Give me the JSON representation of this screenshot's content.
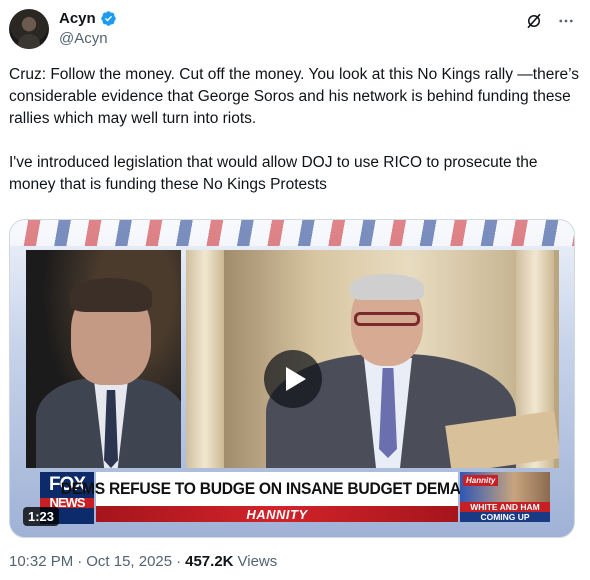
{
  "author": {
    "display_name": "Acyn",
    "handle": "@Acyn",
    "verified": true,
    "verified_color": "#1d9bf0"
  },
  "header_icons": [
    "grok-icon",
    "more-icon"
  ],
  "tweet": {
    "text": "Cruz: Follow the money. Cut off the money. You look at this No Kings rally —there’s considerable evidence that George Soros and his network is behind funding these rallies which may well turn into riots.\n\nI've introduced legislation that would allow DOJ to use RICO to prosecute the money that is funding these No Kings Protests"
  },
  "video": {
    "duration": "1:23",
    "chyron": {
      "network_line1": "FOX",
      "network_line2": "NEWS",
      "headline": "DEMS REFUSE TO BUDGE ON INSANE BUDGET DEMANDS",
      "show": "HANNITY",
      "promo_badge": "Hannity",
      "promo_line1": "WHITE AND HAM",
      "promo_line2": "COMING UP"
    }
  },
  "meta": {
    "time": "10:32 PM",
    "sep1": "·",
    "date": "Oct 15, 2025",
    "sep2": "·",
    "views_count": "457.2K",
    "views_label": "Views"
  }
}
